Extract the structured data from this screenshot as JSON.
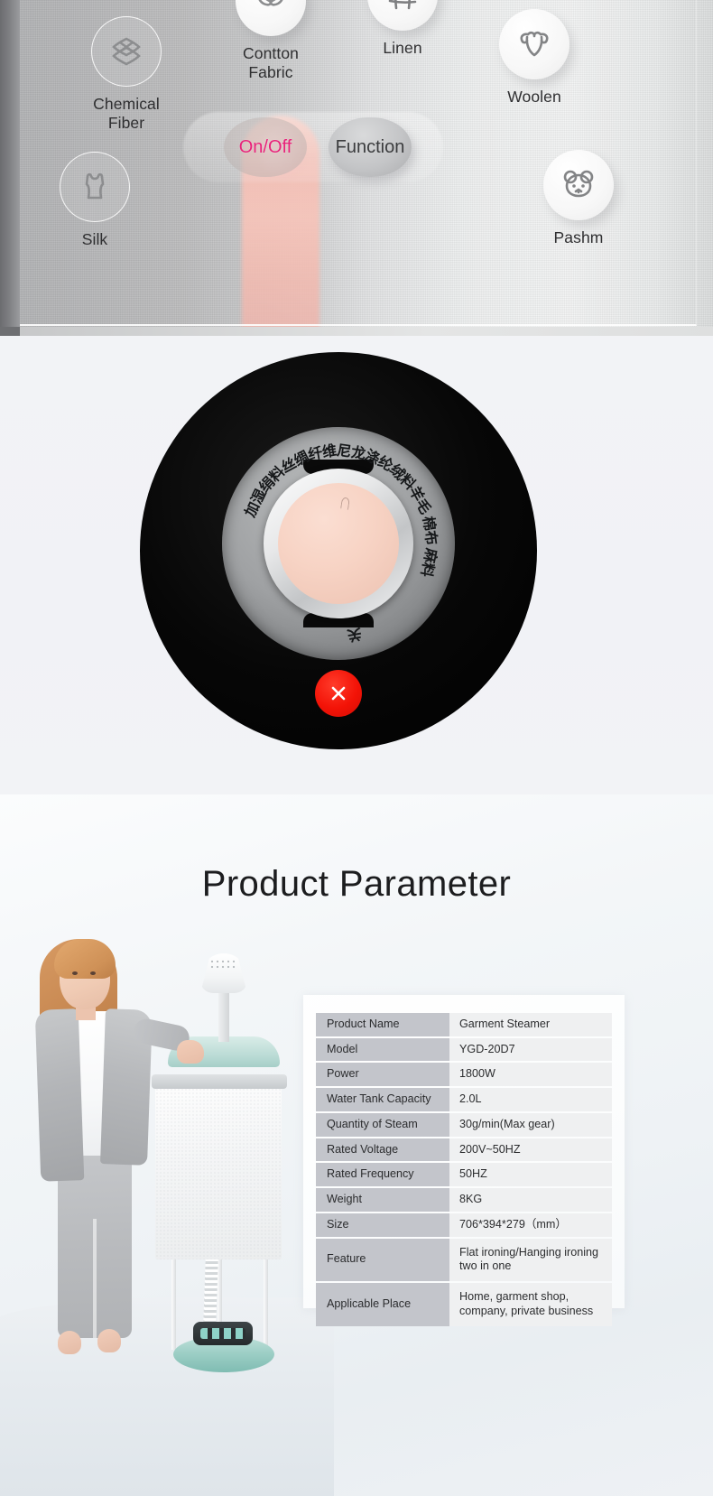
{
  "control_panel": {
    "fabric_icons": [
      {
        "id": "chemical-fiber",
        "label": "Chemical\nFiber",
        "icon": "lattice-icon"
      },
      {
        "id": "cotton-fabric",
        "label": "Contton\nFabric",
        "icon": "cotton-boll-icon"
      },
      {
        "id": "linen",
        "label": "Linen",
        "icon": "weave-grid-icon"
      },
      {
        "id": "woolen",
        "label": "Woolen",
        "icon": "ram-head-icon"
      },
      {
        "id": "silk",
        "label": "Silk",
        "icon": "camisole-icon"
      },
      {
        "id": "pashm",
        "label": "Pashm",
        "icon": "bear-head-icon"
      }
    ],
    "buttons": [
      {
        "id": "on-off",
        "label": "On/Off",
        "color": "#e8227a"
      },
      {
        "id": "function",
        "label": "Function",
        "color": "#3b3c3e"
      }
    ]
  },
  "dial": {
    "labels": [
      "加湿",
      "绢料",
      "丝绸",
      "纤维",
      "尼龙",
      "涤纶",
      "绒料",
      "羊毛",
      "棉布",
      "麻料",
      "关"
    ],
    "power_icon": "power-x-icon",
    "power_color": "#f31307"
  },
  "parameters": {
    "title": "Product Parameter",
    "rows": [
      {
        "key": "Product Name",
        "value": "Garment Steamer"
      },
      {
        "key": "Model",
        "value": "YGD-20D7"
      },
      {
        "key": "Power",
        "value": "1800W"
      },
      {
        "key": "Water Tank Capacity",
        "value": "2.0L"
      },
      {
        "key": "Quantity of Steam",
        "value": "30g/min(Max gear)"
      },
      {
        "key": "Rated Voltage",
        "value": "200V~50HZ"
      },
      {
        "key": "Rated Frequency",
        "value": "50HZ"
      },
      {
        "key": "Weight",
        "value": "8KG"
      },
      {
        "key": "Size",
        "value": "706*394*279（mm）"
      },
      {
        "key": "Feature",
        "value": "Flat ironing/Hanging ironing two in one"
      },
      {
        "key": "Applicable Place",
        "value": "Home, garment shop, company, private business"
      }
    ]
  }
}
